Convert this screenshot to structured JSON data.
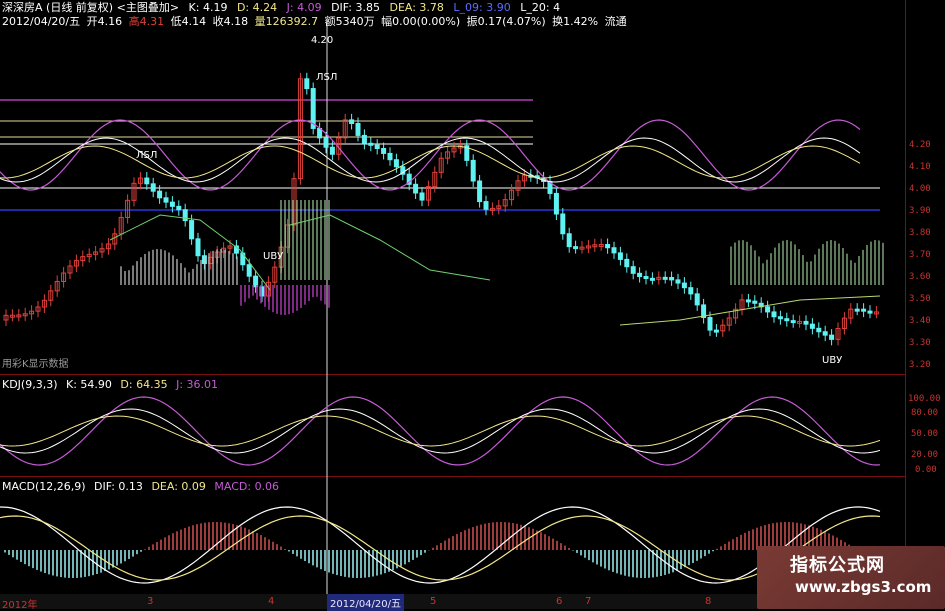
{
  "header": {
    "stock": "深深房A (日线 前复权) <主图叠加>",
    "k": "K: 4.19",
    "d": "D: 4.24",
    "j": "J: 4.09",
    "dif": "DIF: 3.85",
    "dea": "DEA: 3.78",
    "right_tail": "L_20: 4",
    "right_small": "L_09: 3.90",
    "line2_date": "2012/04/20/五",
    "line2_open": "开4.16",
    "line2_high": "高4.31",
    "line2_low": "低4.14",
    "line2_close": "收4.18",
    "line2_vol": "量126392.7",
    "line2_amt": "额5340万",
    "line2_chg": "幅0.00(0.00%)",
    "line2_amp": "振0.17(4.07%)",
    "line2_turn": "换1.42%",
    "line2_tail": "流通"
  },
  "main_chart": {
    "annotations": [
      "4.20",
      "ЛSЛ",
      "ЛSЛ",
      "UBУ",
      "UBУ"
    ],
    "ylabels": [
      "4.20",
      "4.10",
      "4.00",
      "3.90",
      "3.80",
      "3.70",
      "3.60",
      "3.50",
      "3.40",
      "3.30",
      "3.20"
    ],
    "footer_note": "用彩K显示数据"
  },
  "kdj": {
    "label": "KDJ(9,3,3)",
    "k": "K: 54.90",
    "d": "D: 64.35",
    "j": "J: 36.01",
    "ylabels": [
      "100.00",
      "80.00",
      "50.00",
      "20.00",
      "0.00"
    ]
  },
  "macd": {
    "label": "MACD(12,26,9)",
    "dif": "DIF: 0.13",
    "dea": "DEA: 0.09",
    "macd": "MACD: 0.06"
  },
  "date_axis": {
    "labels": [
      "2012年",
      "3",
      "4",
      "5",
      "6",
      "7",
      "8"
    ],
    "crosshair": "2012/04/20/五"
  },
  "watermark": {
    "line1": "指标公式网",
    "line2": "www.zbgs3.com"
  },
  "colors": {
    "up": "#e0413a",
    "down": "#5ff2f2",
    "axis": "#c8332f",
    "k_line": "#ffffff",
    "d_line": "#f3e68a",
    "j_line": "#c65bd6",
    "dif_line": "#ffffff",
    "dea_line": "#f3e68a"
  }
}
